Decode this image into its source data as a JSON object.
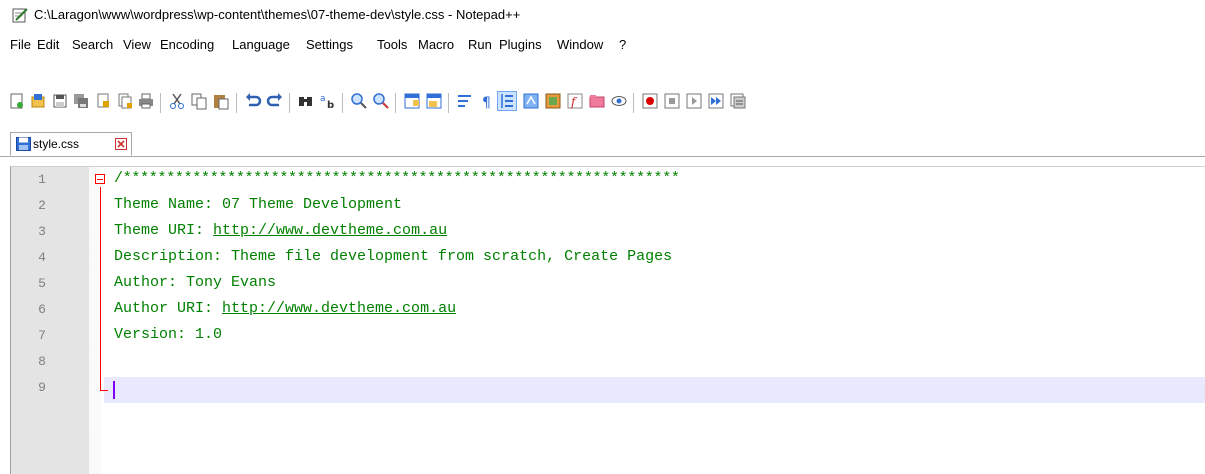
{
  "window": {
    "title": "C:\\Laragon\\www\\wordpress\\wp-content\\themes\\07-theme-dev\\style.css - Notepad++"
  },
  "menu": {
    "items": [
      "File",
      "Edit",
      "Search",
      "View",
      "Encoding",
      "Language",
      "Settings",
      "Tools",
      "Macro",
      "Run",
      "Plugins",
      "Window",
      "?"
    ]
  },
  "toolbar": {
    "icons": [
      "new-file-icon",
      "open-file-icon",
      "save-icon",
      "save-all-icon",
      "close-icon",
      "close-all-icon",
      "print-icon",
      "cut-icon",
      "copy-icon",
      "paste-icon",
      "undo-icon",
      "redo-icon",
      "find-icon",
      "replace-icon",
      "zoom-in-icon",
      "zoom-out-icon",
      "sync-vertical-icon",
      "sync-horizontal-icon",
      "word-wrap-icon",
      "show-all-chars-icon",
      "indent-guide-icon",
      "user-language-icon",
      "doc-map-icon",
      "function-list-icon",
      "folder-workspace-icon",
      "monitoring-icon",
      "record-macro-icon",
      "stop-recording-icon",
      "playback-icon",
      "run-macro-multiple-icon",
      "save-macro-icon"
    ]
  },
  "tabs": [
    {
      "label": "style.css"
    }
  ],
  "editor": {
    "line_numbers": [
      "1",
      "2",
      "3",
      "4",
      "5",
      "6",
      "7",
      "8",
      "9"
    ],
    "lines": [
      {
        "text": "/****************************************************************"
      },
      {
        "text": "Theme Name: 07 Theme Development"
      },
      {
        "prefix": "Theme URI: ",
        "url": "http://www.devtheme.com.au"
      },
      {
        "text": "Description: Theme file development from scratch, Create Pages"
      },
      {
        "text": "Author: Tony Evans"
      },
      {
        "prefix": "Author URI: ",
        "url": "http://www.devtheme.com.au"
      },
      {
        "text": "Version: 1.0"
      },
      {
        "text": ""
      },
      {
        "text": ""
      }
    ],
    "current_line": 9,
    "colors": {
      "comment": "#008000",
      "fold_marker": "#ff0000",
      "caret": "#8000ff",
      "current_line_bg": "#e8e8ff",
      "gutter_bg": "#e4e4e4"
    }
  }
}
